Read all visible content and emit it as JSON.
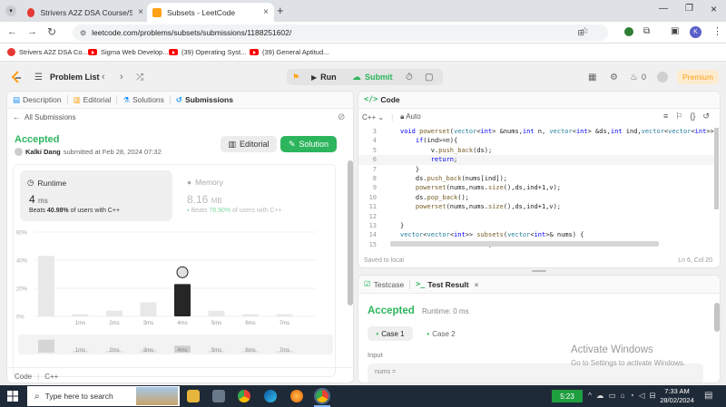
{
  "browser": {
    "tabs": [
      {
        "title": "Strivers A2Z DSA Course/Sheet",
        "active": false
      },
      {
        "title": "Subsets - LeetCode",
        "active": true
      }
    ],
    "url": "leetcode.com/problems/subsets/submissions/1188251602/",
    "profile_initial": "K",
    "bookmarks": [
      "Strivers A2Z DSA Co...",
      "Sigma Web Develop...",
      "(39) Operating Syst...",
      "(39) General Aptitud..."
    ]
  },
  "header": {
    "problem_list": "Problem List",
    "run": "Run",
    "submit": "Submit",
    "coins": "0",
    "premium": "Premium"
  },
  "left_tabs": {
    "description": "Description",
    "editorial": "Editorial",
    "solutions": "Solutions",
    "submissions": "Submissions"
  },
  "submission": {
    "back": "All Submissions",
    "status": "Accepted",
    "user": "Kalki Dang",
    "submitted_at": "submitted at Feb 28, 2024 07:32",
    "editorial_btn": "Editorial",
    "solution_btn": "Solution",
    "runtime_label": "Runtime",
    "runtime_value": "4",
    "runtime_unit": "ms",
    "runtime_beats_prefix": "Beats",
    "runtime_beats": "40.98%",
    "runtime_beats_suffix": "of users with C++",
    "memory_label": "Memory",
    "memory_value": "8.16",
    "memory_unit": "MB",
    "memory_beats_prefix": "Beats",
    "memory_beats": "78.90%",
    "memory_beats_suffix": "of users with C++",
    "footer_code": "Code",
    "footer_lang": "C++"
  },
  "chart_data": {
    "type": "bar",
    "categories": [
      "",
      "1ms",
      "2ms",
      "3ms",
      "4ms",
      "5ms",
      "6ms",
      "7ms"
    ],
    "values": [
      43,
      1.5,
      4,
      10,
      23,
      4,
      1.5,
      1.5
    ],
    "highlight_index": 4,
    "yticks": [
      "60%",
      "40%",
      "20%",
      "0%"
    ],
    "ylim": [
      0,
      60
    ],
    "mini_labels": [
      "1ms",
      "2ms",
      "3ms",
      "4ms",
      "5ms",
      "6ms",
      "7ms"
    ]
  },
  "editor": {
    "title": "Code",
    "lang": "C++",
    "mode": "Auto",
    "lines": [
      {
        "n": "3",
        "t": "void powerset(vector<int> &nums,int n, vector<int> &ds,int ind,vector<vector<int>> &"
      },
      {
        "n": "4",
        "t": "    if(ind>=n){"
      },
      {
        "n": "5",
        "t": "        v.push_back(ds);"
      },
      {
        "n": "6",
        "t": "        return;"
      },
      {
        "n": "7",
        "t": "    }"
      },
      {
        "n": "8",
        "t": "    ds.push_back(nums[ind]);"
      },
      {
        "n": "9",
        "t": "    powerset(nums,nums.size(),ds,ind+1,v);"
      },
      {
        "n": "10",
        "t": "    ds.pop_back();"
      },
      {
        "n": "11",
        "t": "    powerset(nums,nums.size(),ds,ind+1,v);"
      },
      {
        "n": "12",
        "t": ""
      },
      {
        "n": "13",
        "t": "}"
      },
      {
        "n": "14",
        "t": "vector<vector<int>> subsets(vector<int>& nums) {"
      },
      {
        "n": "15",
        "t": "  vector<vector<int>> v;"
      }
    ],
    "saved": "Saved to local",
    "cursor": "Ln 6, Col 20"
  },
  "console": {
    "testcase_tab": "Testcase",
    "result_tab": "Test Result",
    "status": "Accepted",
    "runtime": "Runtime: 0 ms",
    "case1": "Case 1",
    "case2": "Case 2",
    "input_label": "Input",
    "input_var": "nums =",
    "watermark_title": "Activate Windows",
    "watermark_sub": "Go to Settings to activate Windows."
  },
  "taskbar": {
    "search": "Type here to search",
    "timer": "5:23",
    "time": "7:33 AM",
    "date": "28/02/2024"
  }
}
